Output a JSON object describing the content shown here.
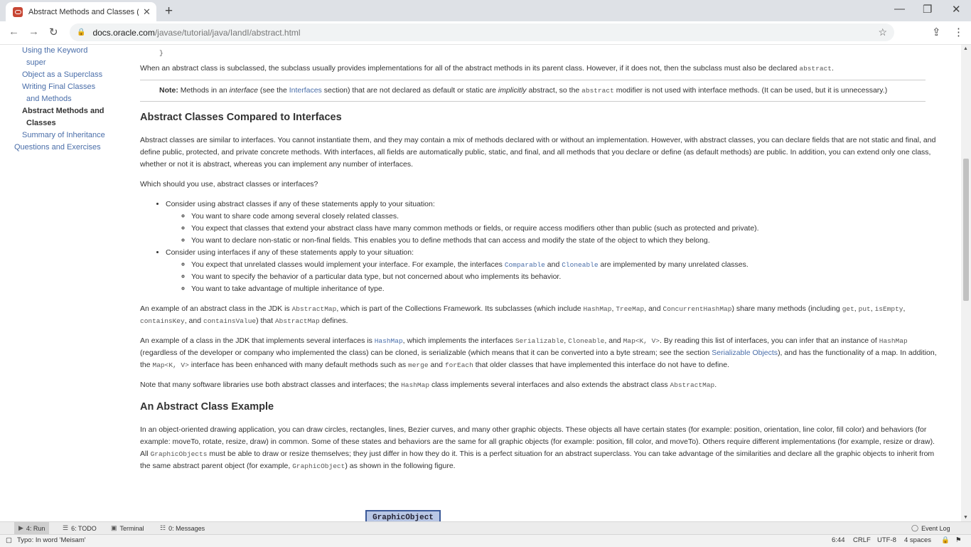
{
  "browser": {
    "tab_title": "Abstract Methods and Classes (T",
    "url_host": "docs.oracle.com",
    "url_path": "/javase/tutorial/java/IandI/abstract.html"
  },
  "sidebar": {
    "items": [
      "Using the Keyword",
      "super",
      "Object as a Superclass",
      "Writing Final Classes",
      "and Methods",
      "Abstract Methods and",
      "Classes",
      "Summary of Inheritance",
      "Questions and Exercises"
    ]
  },
  "content": {
    "brace": "}",
    "p_sub1": "When an abstract class is subclassed, the subclass usually provides implementations for all of the abstract methods in its parent class. However, if it does not, then the subclass must also be declared",
    "code_abstract": "abstract",
    "note_label": "Note:",
    "note_t1": " Methods in an ",
    "note_interface": "interface",
    "note_t2": " (see the ",
    "note_link": "Interfaces",
    "note_t3": " section) that are not declared as default or static are ",
    "note_implicitly": "implicitly",
    "note_t4": " abstract, so the ",
    "note_t5": " modifier is not used with interface methods. (It can be used, but it is unnecessary.)",
    "h_compare": "Abstract Classes Compared to Interfaces",
    "p_compare": "Abstract classes are similar to interfaces. You cannot instantiate them, and they may contain a mix of methods declared with or without an implementation. However, with abstract classes, you can declare fields that are not static and final, and define public, protected, and private concrete methods. With interfaces, all fields are automatically public, static, and final, and all methods that you declare or define (as default methods) are public. In addition, you can extend only one class, whether or not it is abstract, whereas you can implement any number of interfaces.",
    "p_which": "Which should you use, abstract classes or interfaces?",
    "li_abs": "Consider using abstract classes if any of these statements apply to your situation:",
    "li_abs_1": "You want to share code among several closely related classes.",
    "li_abs_2": "You expect that classes that extend your abstract class have many common methods or fields, or require access modifiers other than public (such as protected and private).",
    "li_abs_3": "You want to declare non-static or non-final fields. This enables you to define methods that can access and modify the state of the object to which they belong.",
    "li_int": "Consider using interfaces if any of these statements apply to your situation:",
    "li_int_1a": "You expect that unrelated classes would implement your interface. For example, the interfaces ",
    "code_comparable": "Comparable",
    "t_and": " and ",
    "code_cloneable": "Cloneable",
    "li_int_1b": " are implemented by many unrelated classes.",
    "li_int_2": "You want to specify the behavior of a particular data type, but not concerned about who implements its behavior.",
    "li_int_3": "You want to take advantage of multiple inheritance of type.",
    "p_ex1_a": "An example of an abstract class in the JDK is ",
    "code_abstractmap": "AbstractMap",
    "p_ex1_b": ", which is part of the Collections Framework. Its subclasses (which include ",
    "code_hashmap": "HashMap",
    "t_comma": ", ",
    "code_treemap": "TreeMap",
    "t_comma_and": ", and ",
    "code_chm": "ConcurrentHashMap",
    "p_ex1_c": ") share many methods (including ",
    "code_get": "get",
    "code_put": "put",
    "code_isempty": "isEmpty",
    "code_containskey": "containsKey",
    "code_containsvalue": "containsValue",
    "p_ex1_d": ") that ",
    "p_ex1_e": " defines.",
    "p_ex2_a": "An example of a class in the JDK that implements several interfaces is ",
    "p_ex2_b": ", which implements the interfaces ",
    "code_serializable": "Serializable",
    "code_mapkv": "Map<K, V>",
    "p_ex2_c": ". By reading this list of interfaces, you can infer that an instance of ",
    "p_ex2_d": " (regardless of the developer or company who implemented the class) can be cloned, is serializable (which means that it can be converted into a byte stream; see the section ",
    "link_serobj": "Serializable Objects",
    "p_ex2_e": "), and has the functionality of a map. In addition, the ",
    "p_ex2_f": " interface has been enhanced with many default methods such as ",
    "code_merge": "merge",
    "code_foreach": "forEach",
    "p_ex2_g": " that older classes that have implemented this interface do not have to define.",
    "p_note_a": "Note that many software libraries use both abstract classes and interfaces; the ",
    "p_note_b": " class implements several interfaces and also extends the abstract class ",
    "t_period": ".",
    "h_example": "An Abstract Class Example",
    "p_go_a": "In an object-oriented drawing application, you can draw circles, rectangles, lines, Bezier curves, and many other graphic objects. These objects all have certain states (for example: position, orientation, line color, fill color) and behaviors (for example: moveTo, rotate, resize, draw) in common. Some of these states and behaviors are the same for all graphic objects (for example: position, fill color, and moveTo). Others require different implementations (for example, resize or draw). All ",
    "code_graphicobjects": "GraphicObjects",
    "p_go_b": " must be able to draw or resize themselves; they just differ in how they do it. This is a perfect situation for an abstract superclass. You can take advantage of the similarities and declare all the graphic objects to inherit from the same abstract parent object (for example, ",
    "code_graphicobject": "GraphicObject",
    "p_go_c": ") as shown in the following figure.",
    "figure_label": "GraphicObject"
  },
  "ide": {
    "tool_run": "4: Run",
    "tool_todo": "6: TODO",
    "tool_terminal": "Terminal",
    "tool_messages": "0: Messages",
    "event_log": "Event Log",
    "status_msg": "Typo: In word 'Meisam'",
    "pos": "6:44",
    "crlf": "CRLF",
    "enc": "UTF-8",
    "indent": "4 spaces"
  },
  "colors": {
    "link": "#4a6ea9",
    "oracle_red": "#c74634",
    "figure_fill": "#b9c7e5"
  }
}
